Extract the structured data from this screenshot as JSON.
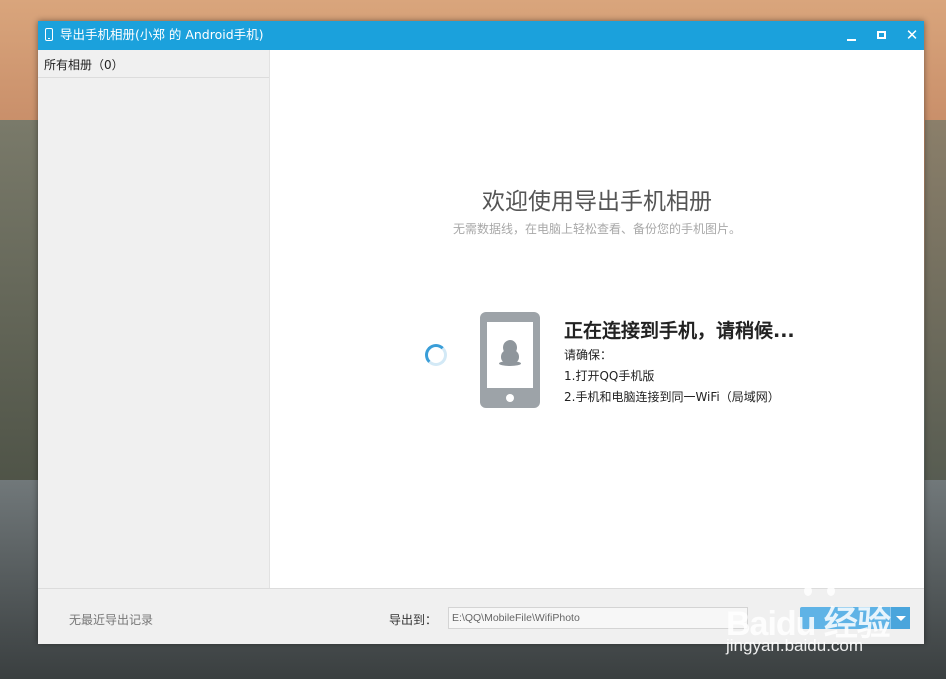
{
  "window": {
    "title": "导出手机相册(小郑 的 Android手机)",
    "minimize_icon": "minimize-icon",
    "maximize_icon": "maximize-icon",
    "close_glyph": "✕"
  },
  "sidebar": {
    "header": "所有相册（0）"
  },
  "main": {
    "welcome_title": "欢迎使用导出手机相册",
    "welcome_subtitle": "无需数据线，在电脑上轻松查看、备份您的手机图片。",
    "connecting": {
      "title": "正在连接到手机，请稍候...",
      "ensure_label": "请确保：",
      "step1": "1.打开QQ手机版",
      "step2": "2.手机和电脑连接到同一WiFi（局域网）"
    },
    "icons": [
      "loading-spinner-icon",
      "phone-qq-penguin-icon"
    ]
  },
  "footer": {
    "no_record": "无最近导出记录",
    "export_to_label": "导出到：",
    "export_path": "E:\\QQ\\MobileFile\\WifiPhoto"
  },
  "watermark": {
    "logo_text": "Baidu 经验",
    "url": "jingyan.baidu.com"
  },
  "colors": {
    "titlebar": "#1ba1dc",
    "sidebar": "#f0f0f0",
    "spinner": "#3a9ed8",
    "export_button": "#5fb3e6"
  }
}
